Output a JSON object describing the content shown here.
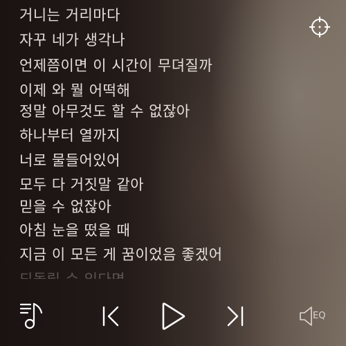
{
  "lyrics": [
    "거니는 거리마다",
    "자꾸 네가 생각나",
    "언제쯤이면 이 시간이 무뎌질까",
    "이제 와 뭘 어떡해",
    "정말 아무것도 할 수 없잖아",
    "하나부터 열까지",
    "너로 물들어있어",
    "모두 다 거짓말 같아",
    "믿을 수 없잖아",
    "아침 눈을 떴을 때",
    "지금 이 모든 게 꿈이었음 좋겠어",
    "되돌릴 수 있다면"
  ],
  "controls": {
    "eq_label": "EQ"
  },
  "icons": {
    "locate": "crosshair-icon",
    "playlist": "music-list-icon",
    "previous": "skip-previous-icon",
    "play": "play-icon",
    "next": "skip-next-icon",
    "equalizer": "speaker-icon"
  },
  "colors": {
    "text": "#f5f0ec",
    "icon": "#ffffff"
  }
}
